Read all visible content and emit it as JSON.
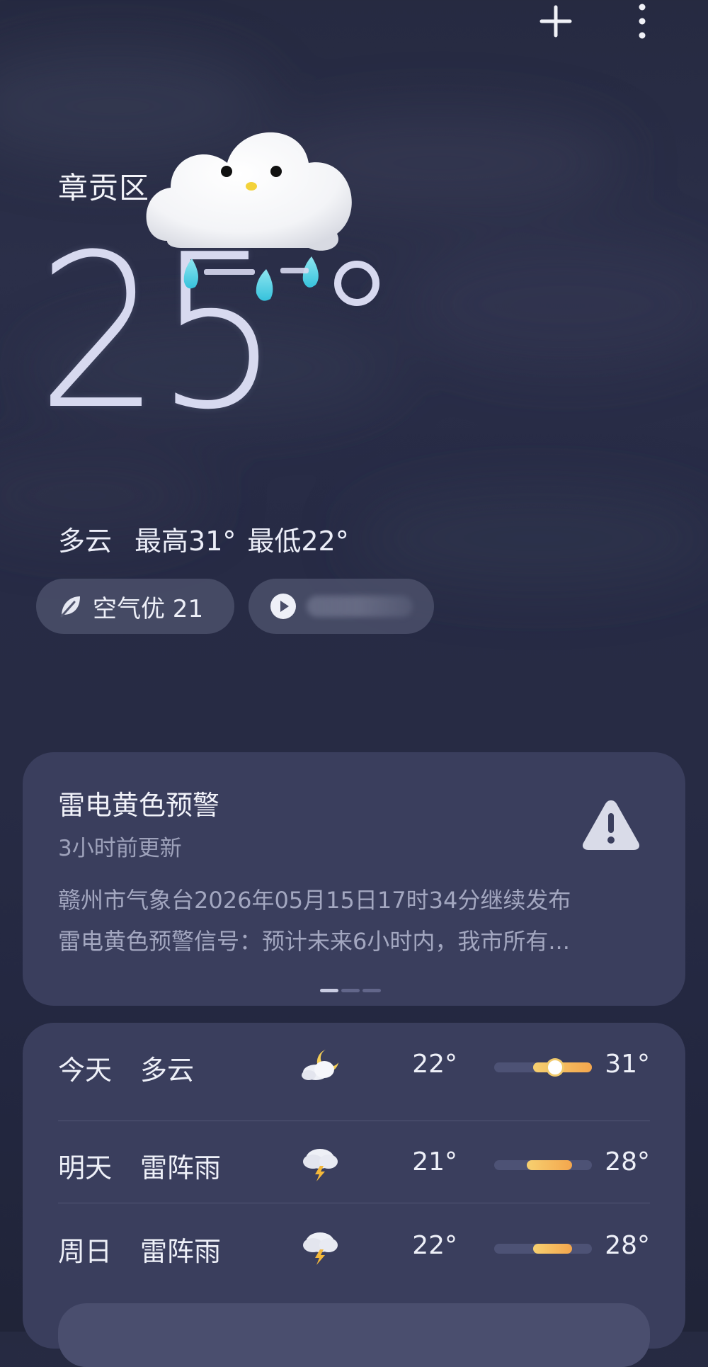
{
  "topbar": {
    "add_icon": "plus-icon",
    "more_icon": "more-vertical-icon"
  },
  "location": "章贡区",
  "current": {
    "temperature": "25",
    "condition": "多云",
    "high_label": "最高31°",
    "low_label": "最低22°"
  },
  "air": {
    "icon": "leaf-icon",
    "label": "空气优 21"
  },
  "media": {
    "icon": "play-icon"
  },
  "alert": {
    "title": "雷电黄色预警",
    "updated": "3小时前更新",
    "body_line1": "赣州市气象台2026年05月15日17时34分继续发布",
    "body_line2": "雷电黄色预警信号：预计未来6小时内，我市所有...",
    "icon": "warning-icon",
    "pages": 3,
    "active_page": 1
  },
  "forecast": [
    {
      "day": "今天",
      "condition": "多云",
      "icon": "partly-cloudy-night-icon",
      "low": "22°",
      "high": "31°",
      "bar_start": 0.4,
      "bar_end": 1.0,
      "current_marker": 0.62
    },
    {
      "day": "明天",
      "condition": "雷阵雨",
      "icon": "thunderstorm-icon",
      "low": "21°",
      "high": "28°",
      "bar_start": 0.33,
      "bar_end": 0.8
    },
    {
      "day": "周日",
      "condition": "雷阵雨",
      "icon": "thunderstorm-icon",
      "low": "22°",
      "high": "28°",
      "bar_start": 0.4,
      "bar_end": 0.8
    }
  ],
  "colors": {
    "background": "#272b45",
    "card": "#3a3e5d",
    "bar_track": "#4d5275",
    "bar_fill_start": "#f6d070",
    "bar_fill_end": "#f4a64d"
  }
}
